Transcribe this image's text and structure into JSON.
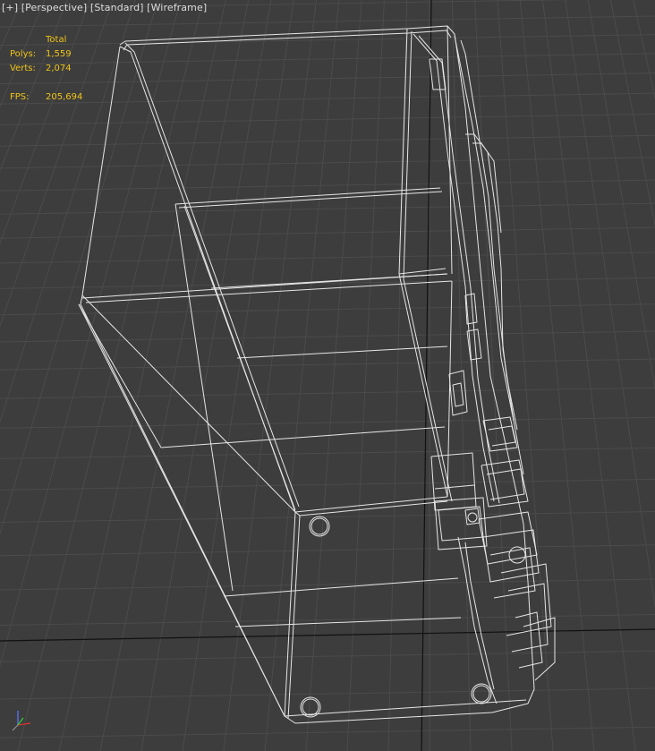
{
  "viewport": {
    "labels": [
      "[+]",
      "[Perspective]",
      "[Standard]",
      "[Wireframe]"
    ]
  },
  "stats": {
    "header": "Total",
    "polys_label": "Polys:",
    "polys_value": "1,559",
    "verts_label": "Verts:",
    "verts_value": "2,074",
    "fps_label": "FPS:",
    "fps_value": "205,694"
  },
  "colors": {
    "background": "#3d3d3d",
    "grid": "#4b4b4b",
    "wire": "#e6e6e6",
    "stats": "#f0c419",
    "axis_x": "#d33",
    "axis_y": "#3c3",
    "axis_z": "#57f"
  },
  "icons": {
    "axis": "axis-tripod-icon"
  }
}
